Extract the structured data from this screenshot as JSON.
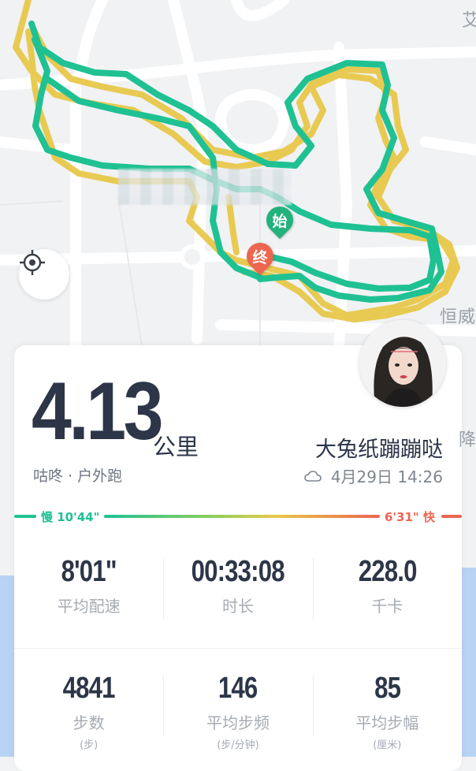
{
  "map": {
    "place_label_top": "艾",
    "place_label_mid": "恒威",
    "place_label_low": "降",
    "start_label": "始",
    "end_label": "终",
    "route_colors": {
      "fast": "#1fc193",
      "slow": "#e8c84a"
    }
  },
  "summary": {
    "distance": "4.13",
    "distance_unit": "公里",
    "source": "咕咚 · 户外跑",
    "username": "大兔纸蹦蹦哒",
    "datetime": "4月29日 14:26",
    "weather_icon": "cloud-icon"
  },
  "pace_scale": {
    "slow_label": "慢 10'44\"",
    "fast_label": "6'31\" 快",
    "colors": {
      "slow": "#1fc193",
      "mid": "#e8c84a",
      "fast": "#ec6650"
    }
  },
  "stats": {
    "row1": [
      {
        "value": "8'01\"",
        "label": "平均配速"
      },
      {
        "value": "00:33:08",
        "label": "时长"
      },
      {
        "value": "228.0",
        "label": "千卡"
      }
    ],
    "row2": [
      {
        "value": "4841",
        "label": "步数",
        "sub": "(步)"
      },
      {
        "value": "146",
        "label": "平均步频",
        "sub": "(步/分钟)"
      },
      {
        "value": "85",
        "label": "平均步幅",
        "sub": "(厘米)"
      }
    ]
  }
}
